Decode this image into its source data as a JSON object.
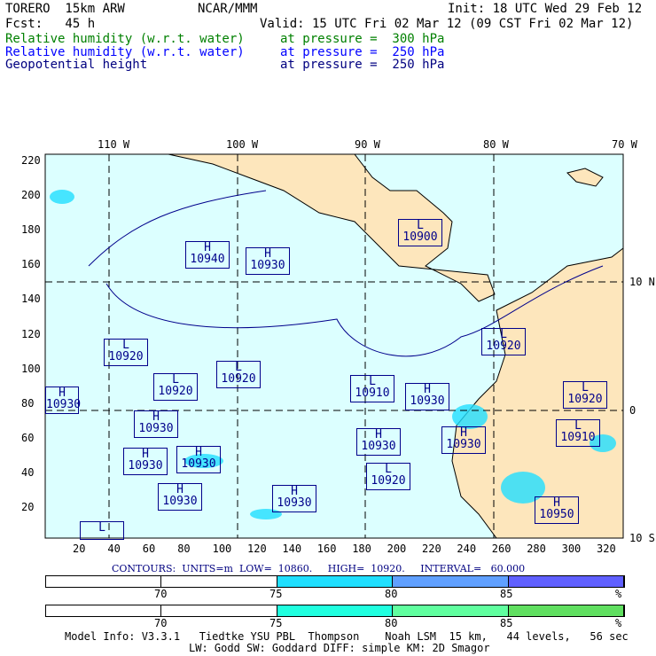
{
  "header": {
    "model": "TORERO  15km ARW",
    "org": "NCAR/MMM",
    "init": "Init: 18 UTC Wed 29 Feb 12",
    "fcst": "Fcst:   45 h",
    "valid": "Valid: 15 UTC Fri 02 Mar 12 (09 CST Fri 02 Mar 12)",
    "fields": [
      {
        "name": "Relative humidity (w.r.t. water)",
        "level": "at pressure =  300 hPa",
        "color": "#008000"
      },
      {
        "name": "Relative humidity (w.r.t. water)",
        "level": "at pressure =  250 hPa",
        "color": "#0000ff"
      },
      {
        "name": "Geopotential height",
        "level": "at pressure =  250 hPa",
        "color": "#000080"
      }
    ]
  },
  "map": {
    "top_labels": [
      "110 W",
      "100 W",
      "90 W",
      "80 W",
      "70 W"
    ],
    "right_labels": [
      "10 N",
      "0",
      "10 S"
    ],
    "x_ticks": [
      "20",
      "40",
      "60",
      "80",
      "100",
      "120",
      "140",
      "160",
      "180",
      "200",
      "220",
      "240",
      "260",
      "280",
      "300",
      "320"
    ],
    "y_ticks": [
      "220",
      "200",
      "180",
      "160",
      "140",
      "120",
      "100",
      "80",
      "60",
      "40",
      "20"
    ],
    "ocean_color": "#dcffff",
    "land_color": "#fde6bc",
    "centers": [
      {
        "t": "H",
        "v": "10940"
      },
      {
        "t": "H",
        "v": "10930"
      },
      {
        "t": "L",
        "v": "10900"
      },
      {
        "t": "L",
        "v": "10920"
      },
      {
        "t": "L",
        "v": "10920"
      },
      {
        "t": "L",
        "v": "10920"
      },
      {
        "t": "H",
        "v": "10930"
      },
      {
        "t": "L",
        "v": "10910"
      },
      {
        "t": "H",
        "v": "10930"
      },
      {
        "t": "L",
        "v": "10920"
      },
      {
        "t": "L",
        "v": "10920"
      },
      {
        "t": "H",
        "v": "10930"
      },
      {
        "t": "H",
        "v": "10930"
      },
      {
        "t": "H",
        "v": "10930"
      },
      {
        "t": "L",
        "v": "10910"
      },
      {
        "t": "H",
        "v": "10930"
      },
      {
        "t": "H",
        "v": "10930"
      },
      {
        "t": "L",
        "v": "10920"
      },
      {
        "t": "H",
        "v": "10930"
      },
      {
        "t": "H",
        "v": "10930"
      },
      {
        "t": "H",
        "v": "10950"
      },
      {
        "t": "L",
        "v": ""
      }
    ]
  },
  "contours": "CONTOURS:  UNITS=m  LOW=  10860.     HIGH=  10920.     INTERVAL=   60.000",
  "legend1": {
    "labels": [
      "70",
      "75",
      "80",
      "85",
      "%"
    ],
    "colors": [
      "#ffffff",
      "#ffffff",
      "#20dfff",
      "#60a0ff",
      "#6060ff"
    ]
  },
  "legend2": {
    "labels": [
      "70",
      "75",
      "80",
      "85",
      "%"
    ],
    "colors": [
      "#ffffff",
      "#ffffff",
      "#20ffdf",
      "#60ff9f",
      "#60df60"
    ]
  },
  "footer": {
    "line1": "Model Info: V3.3.1   Tiedtke YSU PBL  Thompson    Noah LSM  15 km,   44 levels,   56 sec",
    "line2": "LW: Godd SW: Goddard DIFF: simple KM: 2D Smagor"
  }
}
